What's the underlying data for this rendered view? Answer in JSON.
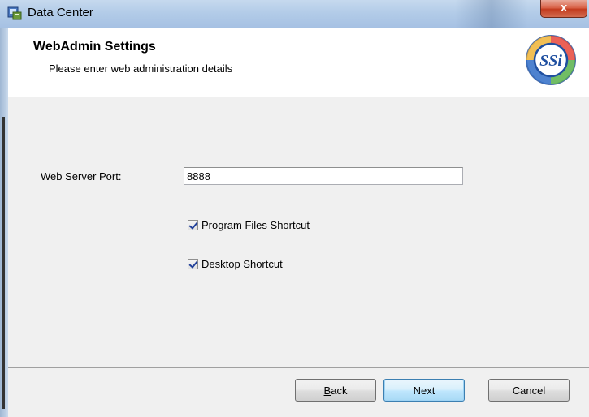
{
  "window": {
    "title": "Data Center",
    "close_label": "x"
  },
  "banner": {
    "title": "WebAdmin Settings",
    "subtitle": "Please enter web administration details",
    "logo_text": "SSi"
  },
  "form": {
    "port_label": "Web Server Port:",
    "port_value": "8888",
    "program_files_shortcut": {
      "label": "Program Files Shortcut",
      "checked": true
    },
    "desktop_shortcut": {
      "label": "Desktop Shortcut",
      "checked": true
    }
  },
  "buttons": {
    "back_mnemonic": "B",
    "back_rest": "ack",
    "next": "Next",
    "cancel": "Cancel"
  },
  "colors": {
    "close_button": "#c8442a",
    "default_button_border": "#3c7fb1",
    "logo_blue": "#1f4fa0"
  }
}
